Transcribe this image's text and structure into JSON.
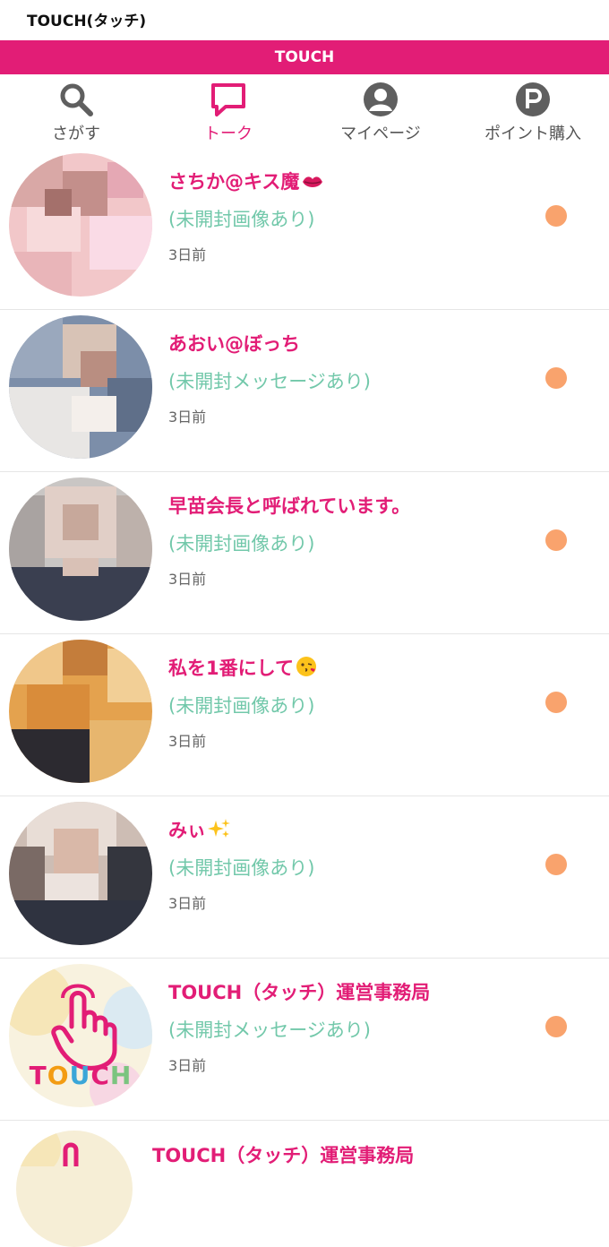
{
  "app": {
    "title": "TOUCH(タッチ)"
  },
  "brand": {
    "label": "TOUCH"
  },
  "tabs": [
    {
      "label": "さがす",
      "icon": "search-icon"
    },
    {
      "label": "トーク",
      "icon": "chat-icon",
      "active": true
    },
    {
      "label": "マイページ",
      "icon": "user-icon"
    },
    {
      "label": "ポイント購入",
      "icon": "points-icon"
    }
  ],
  "messages": [
    {
      "name": "さちか@キス魔",
      "emoji": "lips",
      "status": "(未開封画像あり)",
      "time": "3日前"
    },
    {
      "name": "あおい@ぼっち",
      "emoji": "",
      "status": "(未開封メッセージあり)",
      "time": "3日前"
    },
    {
      "name": "早苗会長と呼ばれています。",
      "emoji": "",
      "status": "(未開封画像あり)",
      "time": "3日前"
    },
    {
      "name": "私を1番にして",
      "emoji": "kiss-face",
      "status": "(未開封画像あり)",
      "time": "3日前"
    },
    {
      "name": "みぃ",
      "emoji": "sparkles",
      "status": "(未開封画像あり)",
      "time": "3日前"
    },
    {
      "name": "TOUCH（タッチ）運営事務局",
      "emoji": "",
      "status": "(未開封メッセージあり)",
      "time": "3日前",
      "official_logo": "TOUCH"
    }
  ],
  "partial_row": {
    "name": "TOUCH（タッチ）運営事務局"
  },
  "colors": {
    "brand": "#e21d76",
    "status": "#72c8aa",
    "unread_dot": "#f9a36d"
  }
}
